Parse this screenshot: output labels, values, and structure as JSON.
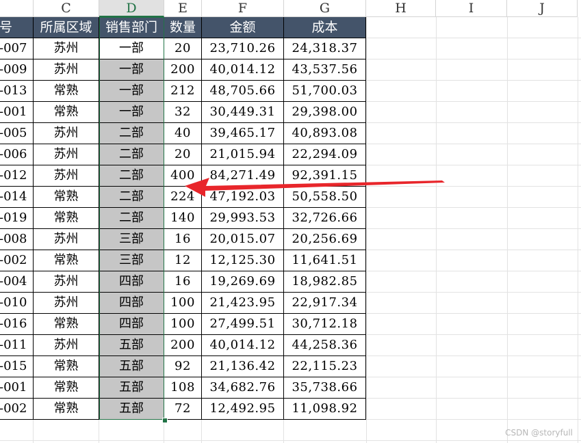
{
  "column_headers": [
    "C",
    "D",
    "E",
    "F",
    "G",
    "H",
    "I",
    "J"
  ],
  "table": {
    "headers": [
      "号",
      "所属区域",
      "销售部门",
      "数量",
      "金额",
      "成本"
    ],
    "rows": [
      [
        "-007",
        "苏州",
        "一部",
        "20",
        "23,710.26",
        "24,318.37"
      ],
      [
        "-009",
        "苏州",
        "一部",
        "200",
        "40,014.12",
        "43,537.56"
      ],
      [
        "-013",
        "常熟",
        "一部",
        "212",
        "48,705.66",
        "51,700.03"
      ],
      [
        "-001",
        "常熟",
        "一部",
        "32",
        "30,449.31",
        "29,398.00"
      ],
      [
        "-005",
        "苏州",
        "二部",
        "40",
        "39,465.17",
        "40,893.08"
      ],
      [
        "-006",
        "苏州",
        "二部",
        "20",
        "21,015.94",
        "22,294.09"
      ],
      [
        "-012",
        "苏州",
        "二部",
        "400",
        "84,271.49",
        "92,391.15"
      ],
      [
        "-014",
        "常熟",
        "二部",
        "224",
        "47,192.03",
        "50,558.50"
      ],
      [
        "-019",
        "常熟",
        "二部",
        "140",
        "29,993.53",
        "32,726.66"
      ],
      [
        "-008",
        "苏州",
        "三部",
        "16",
        "20,015.07",
        "20,256.69"
      ],
      [
        "-002",
        "常熟",
        "三部",
        "12",
        "12,125.30",
        "11,641.51"
      ],
      [
        "-004",
        "苏州",
        "四部",
        "16",
        "19,269.69",
        "18,982.85"
      ],
      [
        "-010",
        "苏州",
        "四部",
        "100",
        "21,423.95",
        "22,917.34"
      ],
      [
        "-016",
        "常熟",
        "四部",
        "100",
        "27,499.51",
        "30,712.18"
      ],
      [
        "-011",
        "苏州",
        "五部",
        "200",
        "40,014.12",
        "44,258.36"
      ],
      [
        "-015",
        "常熟",
        "五部",
        "92",
        "21,136.42",
        "22,115.23"
      ],
      [
        "-001",
        "常熟",
        "五部",
        "108",
        "34,682.76",
        "35,738.66"
      ],
      [
        "-002",
        "常熟",
        "五部",
        "72",
        "12,492.95",
        "11,098.92"
      ]
    ]
  },
  "colors": {
    "header_bg": "#44546a",
    "selection_fill": "#c6c6c6",
    "selection_border": "#217346",
    "arrow": "#e8262b"
  },
  "watermark": "CSDN @storyfull"
}
